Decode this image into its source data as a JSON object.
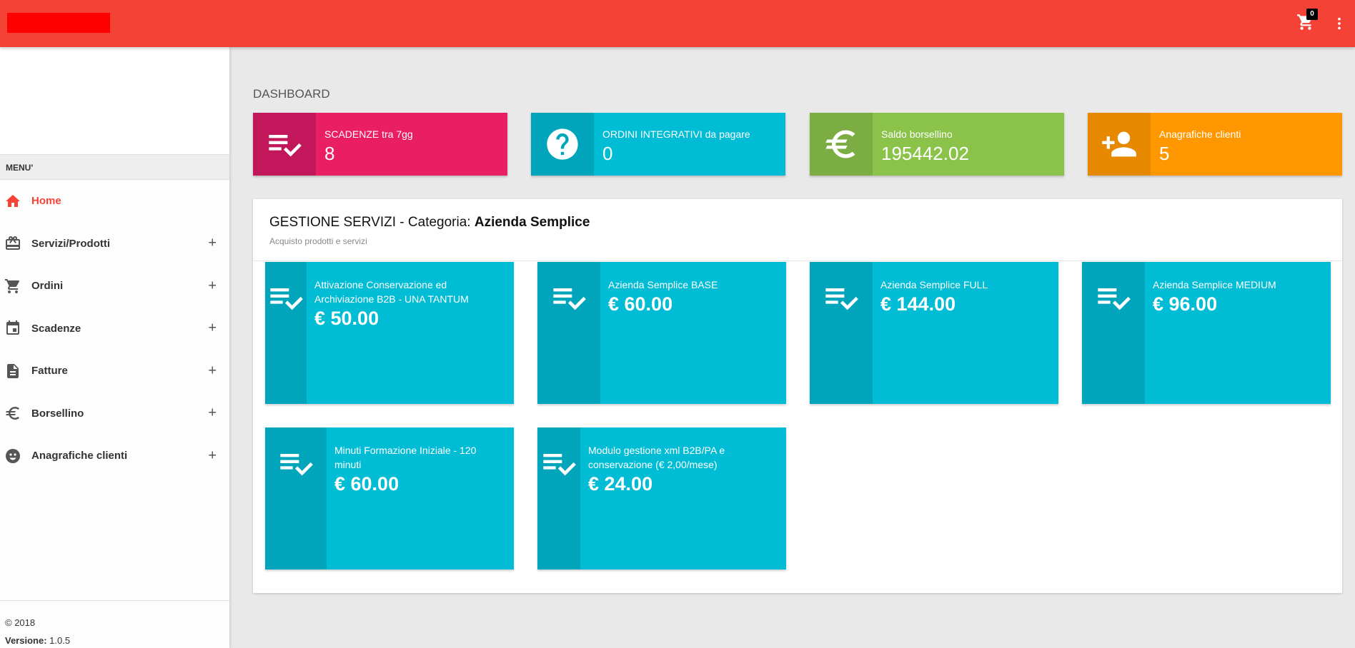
{
  "header": {
    "cart_count": "0",
    "colors": {
      "bar": "#f44336",
      "logo": "#ff0000"
    }
  },
  "sidebar": {
    "menu_title": "MENU'",
    "items": [
      {
        "label": "Home",
        "icon": "home-icon",
        "active": true
      },
      {
        "label": "Servizi/Prodotti",
        "icon": "gift-card-icon"
      },
      {
        "label": "Ordini",
        "icon": "cart-icon"
      },
      {
        "label": "Scadenze",
        "icon": "calendar-icon"
      },
      {
        "label": "Fatture",
        "icon": "document-icon"
      },
      {
        "label": "Borsellino",
        "icon": "euro-icon"
      },
      {
        "label": "Anagrafiche clienti",
        "icon": "face-icon"
      }
    ],
    "expand_symbol": "+",
    "footer": {
      "copyright": "© 2018",
      "version_label": "Versione:",
      "version_value": "1.0.5"
    }
  },
  "dashboard": {
    "title": "DASHBOARD",
    "stats": [
      {
        "label": "SCADENZE tra 7gg",
        "value": "8",
        "icon": "playlist-check-icon",
        "color": "#e91e63",
        "dark": "#c2185b"
      },
      {
        "label": "ORDINI INTEGRATIVI da pagare",
        "value": "0",
        "icon": "help-circle-icon",
        "color": "#00bcd4",
        "dark": "#00a5bb"
      },
      {
        "label": "Saldo borsellino",
        "value": "195442.02",
        "icon": "euro-icon",
        "color": "#8bc34a",
        "dark": "#7cad42"
      },
      {
        "label": "Anagrafiche clienti",
        "value": "5",
        "icon": "person-add-icon",
        "color": "#ff9800",
        "dark": "#e68900"
      }
    ]
  },
  "services": {
    "title_prefix": "GESTIONE SERVIZI - Categoria: ",
    "category": "Azienda Semplice",
    "subtitle": "Acquisto prodotti e servizi",
    "tiles": [
      {
        "label": "Attivazione Conservazione ed Archiviazione B2B - UNA TANTUM",
        "price": "€ 50.00"
      },
      {
        "label": "Azienda Semplice BASE",
        "price": "€ 60.00"
      },
      {
        "label": "Azienda Semplice FULL",
        "price": "€ 144.00"
      },
      {
        "label": "Azienda Semplice MEDIUM",
        "price": "€ 96.00"
      },
      {
        "label": "Minuti Formazione Iniziale - 120 minuti",
        "price": "€ 60.00"
      },
      {
        "label": "Modulo gestione xml B2B/PA e conservazione (€ 2,00/mese)",
        "price": "€ 24.00"
      }
    ],
    "tile_color": "#00bcd4",
    "tile_dark": "#00a5bb"
  }
}
